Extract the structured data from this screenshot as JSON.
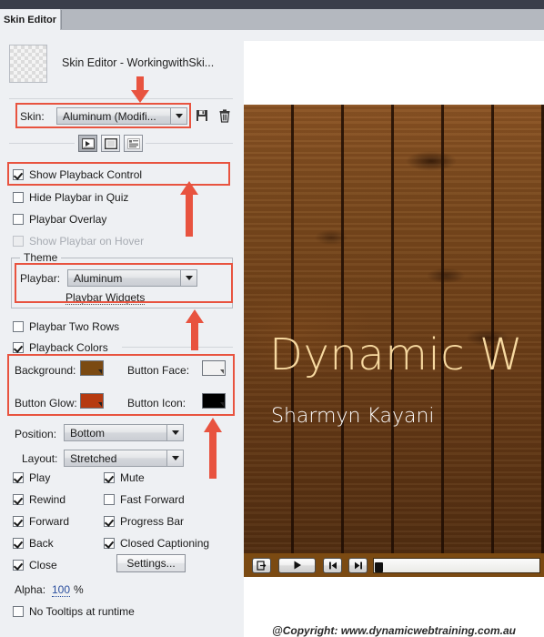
{
  "window": {
    "tab_label": "Skin Editor",
    "document_title": "Skin Editor - WorkingwithSki...",
    "thumbnail_icon": "transparency-checker-thumbnail"
  },
  "skin": {
    "label": "Skin:",
    "value": "Aluminum (Modifi...",
    "save_icon": "floppy-disk-save-icon",
    "delete_icon": "trash-can-delete-icon",
    "toolbar": [
      {
        "name": "playbar-tool",
        "icon": "playbar-icon",
        "selected": true
      },
      {
        "name": "borders-tool",
        "icon": "border-square-icon",
        "selected": false
      },
      {
        "name": "toc-tool",
        "icon": "table-of-contents-icon",
        "selected": false
      }
    ]
  },
  "options": {
    "show_playback_control": {
      "label": "Show Playback Control",
      "checked": true,
      "disabled": false
    },
    "hide_playbar_in_quiz": {
      "label": "Hide Playbar in Quiz",
      "checked": false,
      "disabled": false
    },
    "playbar_overlay": {
      "label": "Playbar Overlay",
      "checked": false,
      "disabled": false
    },
    "show_playbar_on_hover": {
      "label": "Show Playbar on Hover",
      "checked": false,
      "disabled": true
    },
    "playbar_two_rows": {
      "label": "Playbar Two Rows",
      "checked": false,
      "disabled": false
    },
    "playback_colors": {
      "label": "Playback Colors",
      "checked": true,
      "disabled": false
    },
    "no_tooltips": {
      "label": "No Tooltips at runtime",
      "checked": false,
      "disabled": false
    }
  },
  "theme": {
    "group_title": "Theme",
    "playbar_label": "Playbar:",
    "playbar_value": "Aluminum",
    "playbar_widgets_link": "Playbar Widgets"
  },
  "colors": {
    "background": {
      "label": "Background:",
      "value": "#7B4A12"
    },
    "button_face": {
      "label": "Button Face:",
      "value": "#F2F2F2"
    },
    "button_glow": {
      "label": "Button Glow:",
      "value": "#B63A10"
    },
    "button_icon": {
      "label": "Button Icon:",
      "value": "#000000"
    }
  },
  "placement": {
    "position_label": "Position:",
    "position_value": "Bottom",
    "layout_label": "Layout:",
    "layout_value": "Stretched"
  },
  "buttons": [
    {
      "label": "Play",
      "checked": true
    },
    {
      "label": "Mute",
      "checked": true
    },
    {
      "label": "Rewind",
      "checked": true
    },
    {
      "label": "Fast Forward",
      "checked": false
    },
    {
      "label": "Forward",
      "checked": true
    },
    {
      "label": "Progress Bar",
      "checked": true
    },
    {
      "label": "Back",
      "checked": true
    },
    {
      "label": "Closed Captioning",
      "checked": true
    },
    {
      "label": "Close",
      "checked": true
    }
  ],
  "settings_button": "Settings...",
  "alpha": {
    "label": "Alpha:",
    "value": "100",
    "unit": "%"
  },
  "preview": {
    "title": "Dynamic W",
    "subtitle": "Sharmyn Kayani",
    "playbar": {
      "exit_icon": "exit-button-icon",
      "play_icon": "play-triangle-icon",
      "rewind_icon": "rewind-to-start-icon",
      "forward_icon": "forward-to-end-icon",
      "progress_position": 0
    }
  },
  "copyright": "@Copyright: www.dynamicwebtraining.com.au",
  "accent": {
    "annotation": "#E8533F"
  }
}
